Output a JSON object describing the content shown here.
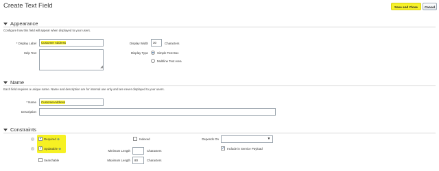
{
  "page": {
    "title": "Create Text Field"
  },
  "toolbar": {
    "save_close": "Save and Close",
    "cancel": "Cancel"
  },
  "appearance": {
    "heading": "Appearance",
    "description": "Configure how this field will appear when displayed to your users.",
    "display_label": {
      "label": "Display Label",
      "value": "Customer Address",
      "required_mark": "*"
    },
    "help_text": {
      "label": "Help Text",
      "value": ""
    },
    "display_width": {
      "label": "Display Width",
      "value": "30",
      "unit": "Characters"
    },
    "display_type": {
      "label": "Display Type",
      "options": [
        "Simple Text Box",
        "Multiline Text Area"
      ],
      "selected": "Simple Text Box"
    }
  },
  "name": {
    "heading": "Name",
    "description": "Each field requires a unique name. Name and description are for internal use only and are never displayed to your users.",
    "name_field": {
      "label": "Name",
      "value": "CustomerAddress",
      "required_mark": "*"
    },
    "description_field": {
      "label": "Description",
      "value": ""
    }
  },
  "constraints": {
    "heading": "Constraints",
    "required": {
      "label": "Required",
      "checked": true
    },
    "updatable": {
      "label": "Updatable",
      "checked": true
    },
    "searchable": {
      "label": "Searchable",
      "checked": false
    },
    "indexed": {
      "label": "Indexed",
      "checked": false
    },
    "minimum_length": {
      "label": "Minimum Length",
      "value": "",
      "unit": "Characters"
    },
    "maximum_length": {
      "label": "Maximum Length",
      "value": "80",
      "unit": "Characters"
    },
    "depends_on": {
      "label": "Depends On",
      "value": ""
    },
    "include_service_payload": {
      "label": "Include in Service Payload",
      "checked": true
    },
    "lock_glyph": "⊕"
  },
  "icons": {
    "help": "help-icon",
    "expand": "triangle-down-icon",
    "lock": "lock-icon",
    "check": "checkmark-icon"
  },
  "colors": {
    "highlight": "#f6f123",
    "accent": "#2a5f98"
  }
}
